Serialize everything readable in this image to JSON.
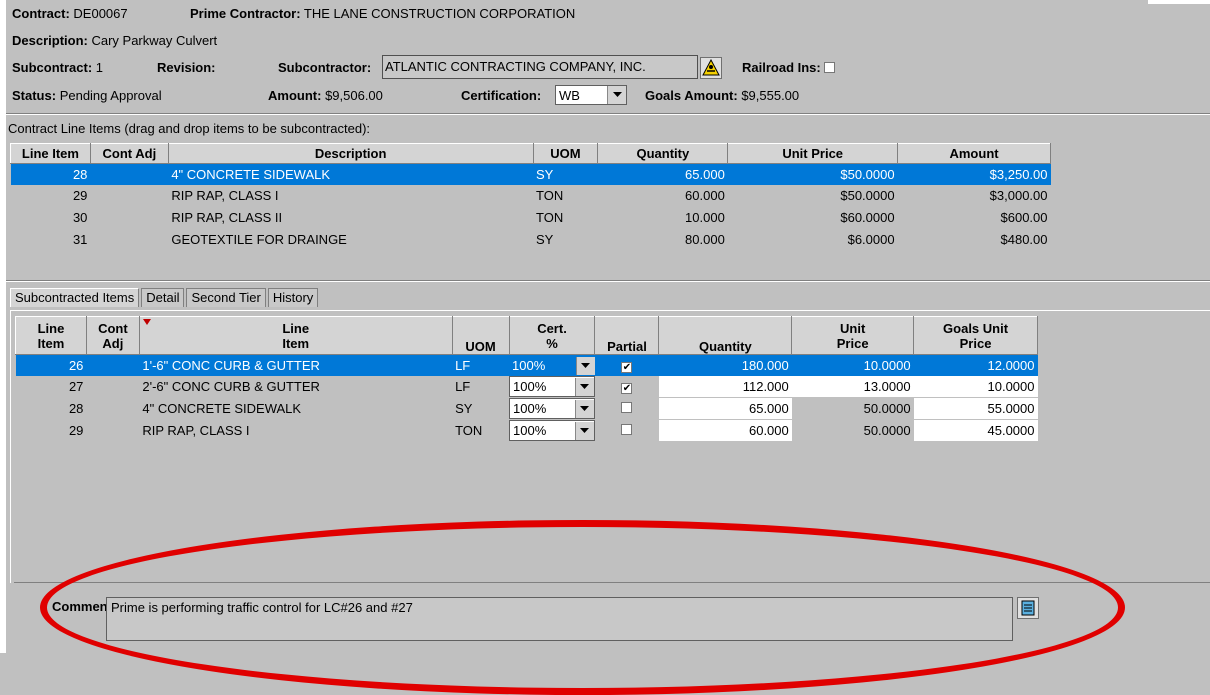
{
  "header": {
    "contract_label": "Contract:",
    "contract_value": "DE00067",
    "prime_label": "Prime Contractor:",
    "prime_value": "THE LANE CONSTRUCTION CORPORATION",
    "description_label": "Description:",
    "description_value": "Cary Parkway Culvert",
    "subcontract_label": "Subcontract:",
    "subcontract_value": "1",
    "revision_label": "Revision:",
    "subcontractor_label": "Subcontractor:",
    "subcontractor_value": "ATLANTIC CONTRACTING COMPANY, INC.",
    "railroad_label": "Railroad Ins:",
    "status_label": "Status:",
    "status_value": "Pending Approval",
    "amount_label": "Amount:",
    "amount_value": "$9,506.00",
    "certification_label": "Certification:",
    "certification_value": "WB",
    "goals_label": "Goals Amount:",
    "goals_value": "$9,555.00"
  },
  "contract_items": {
    "title": "Contract Line Items (drag and drop items to be subcontracted):",
    "columns": [
      "Line Item",
      "Cont Adj",
      "Description",
      "UOM",
      "Quantity",
      "Unit Price",
      "Amount"
    ],
    "rows": [
      {
        "line": "28",
        "adj": "",
        "desc": "4\" CONCRETE SIDEWALK",
        "uom": "SY",
        "qty": "65.000",
        "price": "$50.0000",
        "amount": "$3,250.00"
      },
      {
        "line": "29",
        "adj": "",
        "desc": "RIP RAP, CLASS I",
        "uom": "TON",
        "qty": "60.000",
        "price": "$50.0000",
        "amount": "$3,000.00"
      },
      {
        "line": "30",
        "adj": "",
        "desc": "RIP RAP, CLASS II",
        "uom": "TON",
        "qty": "10.000",
        "price": "$60.0000",
        "amount": "$600.00"
      },
      {
        "line": "31",
        "adj": "",
        "desc": "GEOTEXTILE FOR DRAINGE",
        "uom": "SY",
        "qty": "80.000",
        "price": "$6.0000",
        "amount": "$480.00"
      }
    ]
  },
  "tabs": [
    "Subcontracted Items",
    "Detail",
    "Second Tier",
    "History"
  ],
  "sub_items": {
    "columns": {
      "line1": "Line",
      "line2": "Item",
      "adj1": "Cont",
      "adj2": "Adj",
      "desc1": "Line",
      "desc2": "Item",
      "uom": "UOM",
      "cert1": "Cert.",
      "cert2": "%",
      "partial": "Partial",
      "qty": "Quantity",
      "price1": "Unit",
      "price2": "Price",
      "goals1": "Goals Unit",
      "goals2": "Price"
    },
    "rows": [
      {
        "line": "26",
        "adj": "",
        "desc": "1'-6\" CONC CURB & GUTTER",
        "uom": "LF",
        "cert": "100%",
        "partial": true,
        "qty": "180.000",
        "price": "10.0000",
        "goals": "12.0000"
      },
      {
        "line": "27",
        "adj": "",
        "desc": "2'-6\" CONC CURB & GUTTER",
        "uom": "LF",
        "cert": "100%",
        "partial": true,
        "qty": "112.000",
        "price": "13.0000",
        "goals": "10.0000"
      },
      {
        "line": "28",
        "adj": "",
        "desc": "4\" CONCRETE SIDEWALK",
        "uom": "SY",
        "cert": "100%",
        "partial": false,
        "qty": "65.000",
        "price": "50.0000",
        "goals": "55.0000"
      },
      {
        "line": "29",
        "adj": "",
        "desc": "RIP RAP, CLASS I",
        "uom": "TON",
        "cert": "100%",
        "partial": false,
        "qty": "60.000",
        "price": "50.0000",
        "goals": "45.0000"
      }
    ]
  },
  "comment": {
    "label": "Comment:",
    "value": "Prime is performing traffic control for LC#26 and #27"
  },
  "colors": {
    "selection": "#0078d7",
    "annotation": "#e00000",
    "window_bg": "#c0c0c0"
  },
  "icons": {
    "subcontractor_lookup": "hazard-lookup-icon",
    "comment_edit": "notepad-icon"
  }
}
